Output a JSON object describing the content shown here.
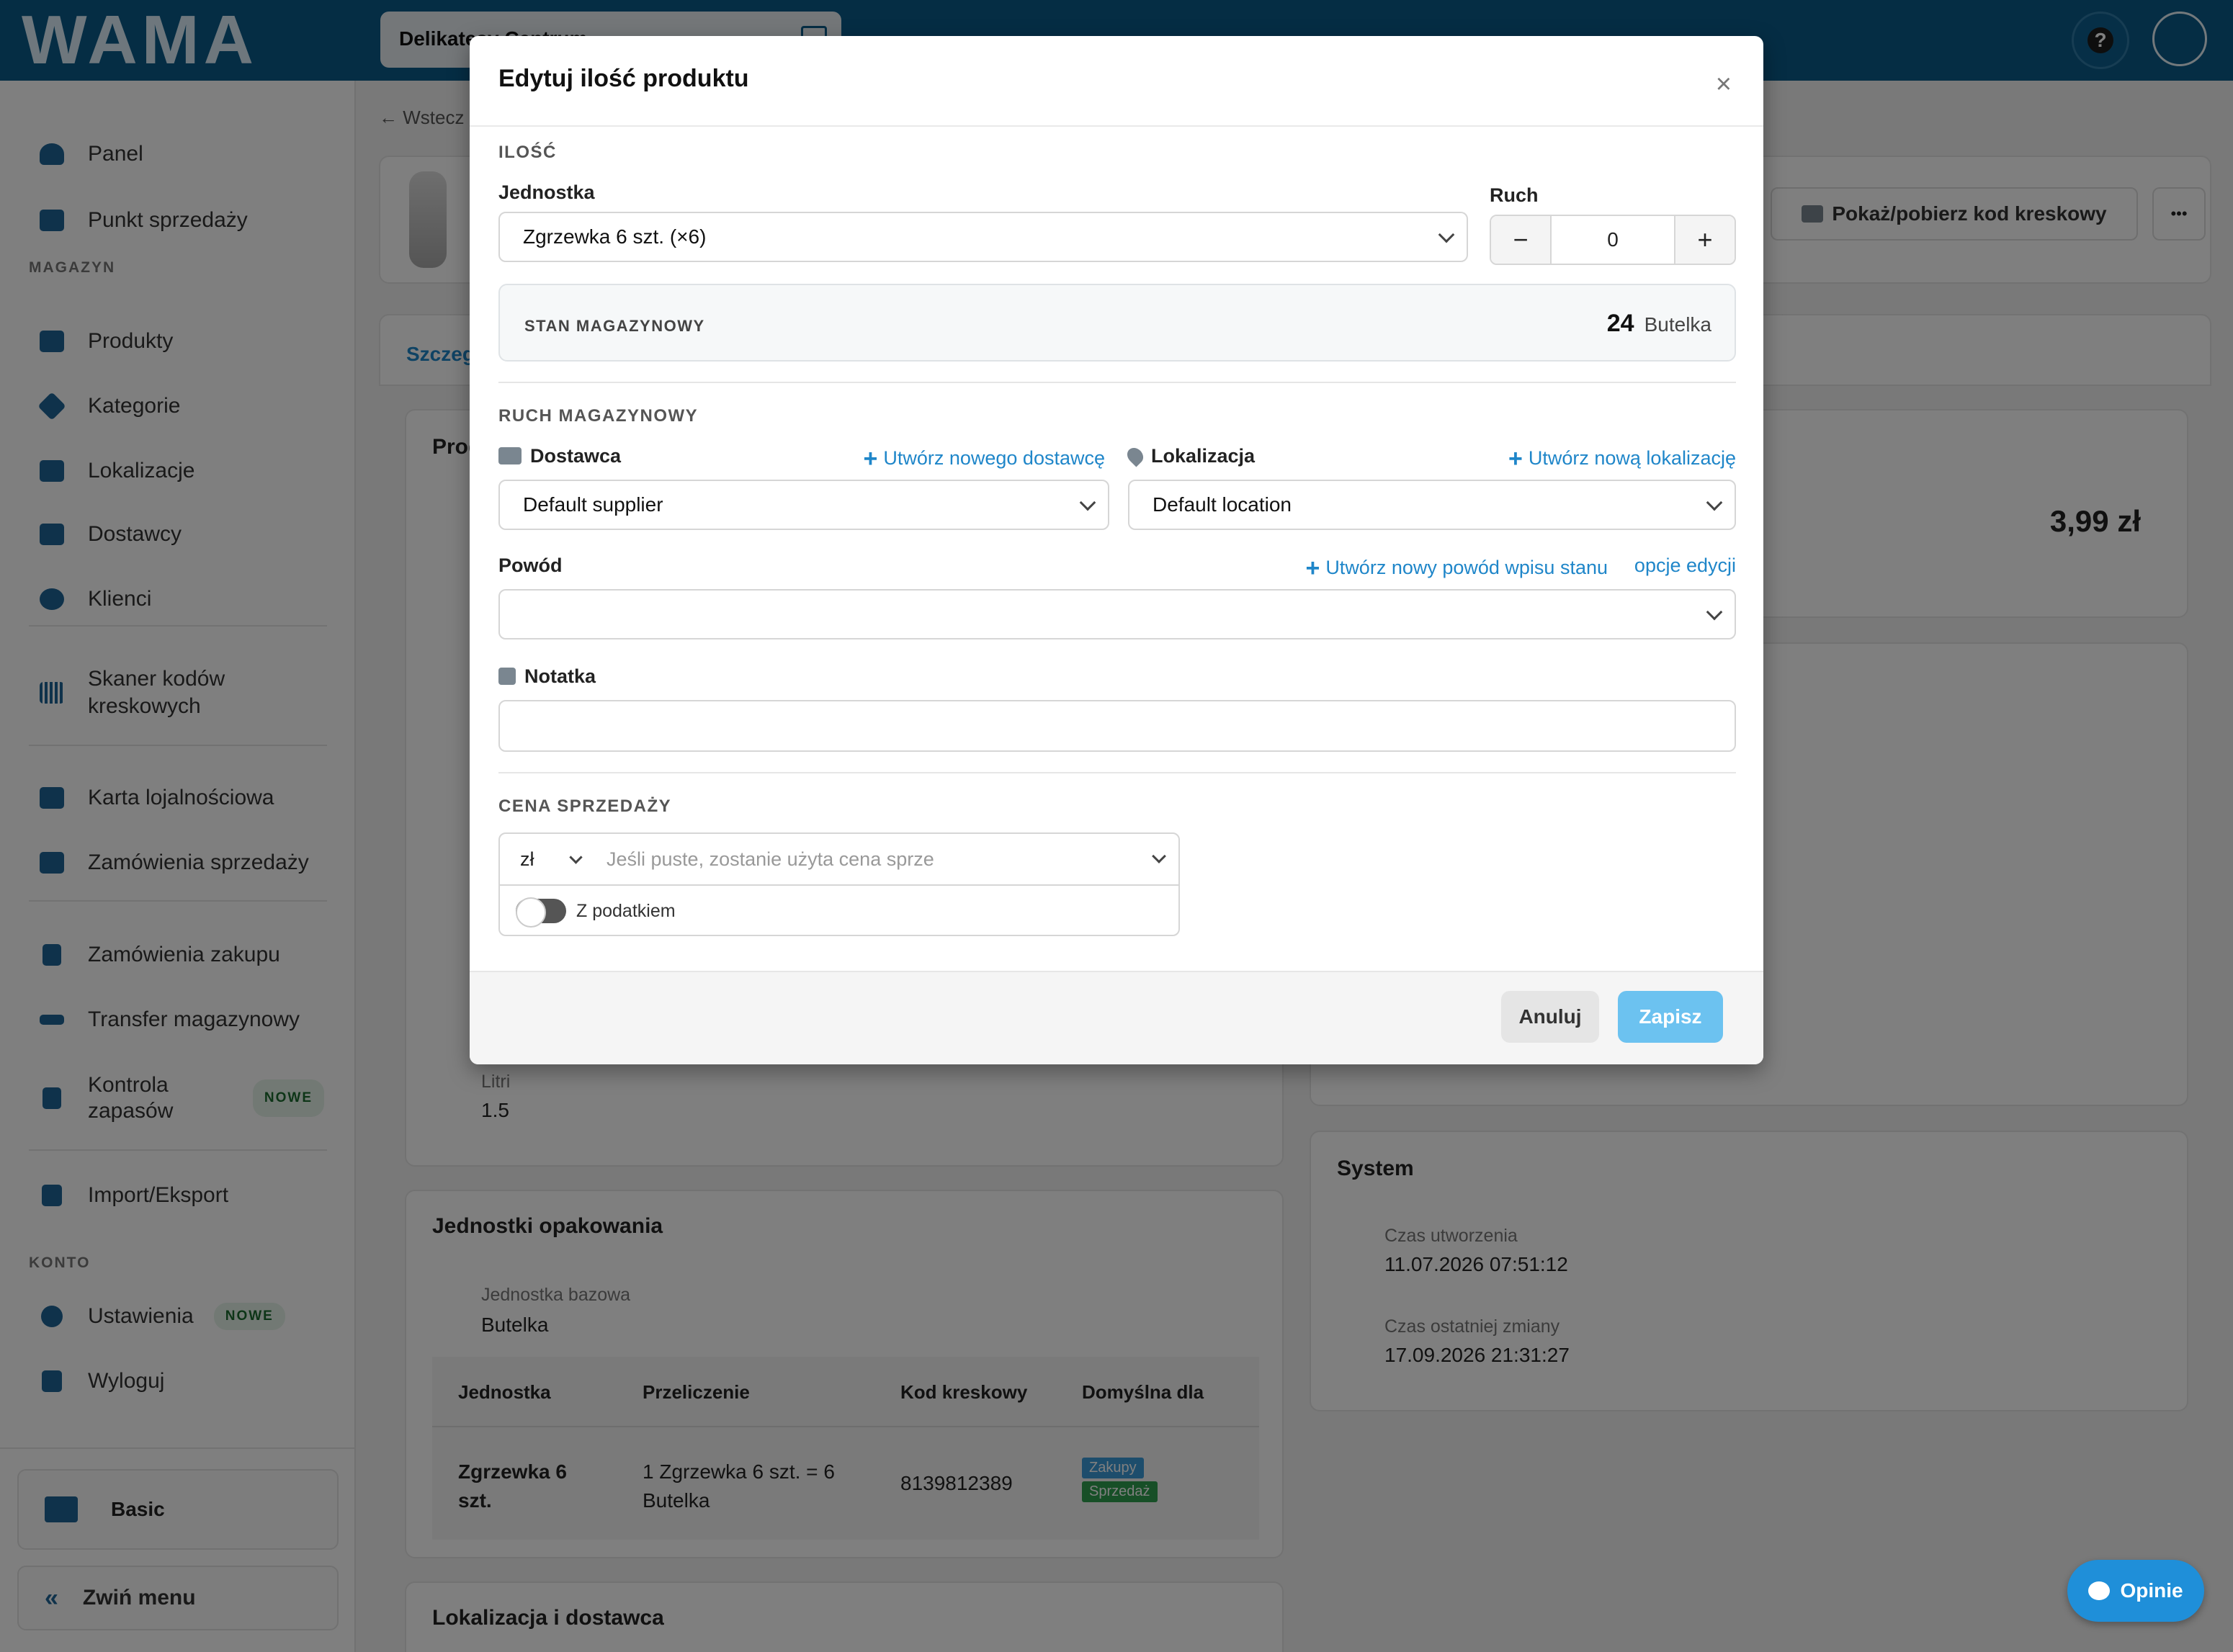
{
  "app": {
    "logo": "WAMA",
    "store": "Delikatesy Centrum",
    "help_label": "?"
  },
  "sidebar": {
    "items": [
      {
        "label": "Panel"
      },
      {
        "label": "Punkt sprzedaży"
      },
      {
        "label": "Produkty"
      },
      {
        "label": "Kategorie"
      },
      {
        "label": "Lokalizacje"
      },
      {
        "label": "Dostawcy"
      },
      {
        "label": "Klienci"
      },
      {
        "label": "Skaner kodów kreskowych"
      },
      {
        "label": "Karta lojalnościowa"
      },
      {
        "label": "Zamówienia sprzedaży"
      },
      {
        "label": "Zamówienia zakupu"
      },
      {
        "label": "Transfer magazynowy"
      },
      {
        "label": "Kontrola zapasów",
        "badge": "NOWE"
      },
      {
        "label": "Import/Eksport"
      },
      {
        "label": "Ustawienia",
        "badge": "NOWE"
      },
      {
        "label": "Wyloguj"
      }
    ],
    "section_magazyn": "MAGAZYN",
    "section_konto": "KONTO",
    "plan": "Basic",
    "collapse": "Zwiń menu"
  },
  "background": {
    "back": "Wstecz",
    "barcode_button": "Pokaż/pobierz kod kreskowy",
    "more": "•••",
    "tab": "Szczegóły",
    "card_title": "Produkt",
    "price": "3,99 zł",
    "unit_label": "Litri",
    "unit_value": "1.5",
    "packaging_title": "Jednostki opakowania",
    "base_unit_label": "Jednostka bazowa",
    "base_unit_value": "Butelka",
    "table_headers": [
      "Jednostka",
      "Przeliczenie",
      "Kod kreskowy",
      "Domyślna dla"
    ],
    "table_row": {
      "unit": "Zgrzewka 6 szt.",
      "conversion": "1 Zgrzewka 6 szt. = 6 Butelka",
      "barcode": "8139812389",
      "tag1": "Zakupy",
      "tag2": "Sprzedaż"
    },
    "location_title": "Lokalizacja i dostawca",
    "system_title": "System",
    "created_label": "Czas utworzenia",
    "created_value": "11.07.2026 07:51:12",
    "modified_label": "Czas ostatniej zmiany",
    "modified_value": "17.09.2026 21:31:27"
  },
  "modal": {
    "title": "Edytuj ilość produktu",
    "close": "×",
    "section_qty": "ILOŚĆ",
    "unit_label": "Jednostka",
    "unit_value": "Zgrzewka 6 szt. (×6)",
    "move_label": "Ruch",
    "move_value": "0",
    "minus": "−",
    "plus": "+",
    "stock_label": "STAN MAGAZYNOWY",
    "stock_value": "24",
    "stock_unit": "Butelka",
    "section_move": "RUCH MAGAZYNOWY",
    "supplier_label": "Dostawca",
    "supplier_create": "Utwórz nowego dostawcę",
    "supplier_value": "Default supplier",
    "location_label": "Lokalizacja",
    "location_create": "Utwórz nową lokalizację",
    "location_value": "Default location",
    "reason_label": "Powód",
    "reason_create": "Utwórz nowy powód wpisu stanu",
    "reason_options": "opcje edycji",
    "note_label": "Notatka",
    "section_price": "CENA SPRZEDAŻY",
    "currency": "zł",
    "price_placeholder": "Jeśli puste, zostanie użyta cena sprze",
    "with_tax": "Z podatkiem",
    "cancel": "Anuluj",
    "save": "Zapisz"
  },
  "feedback": "Opinie"
}
